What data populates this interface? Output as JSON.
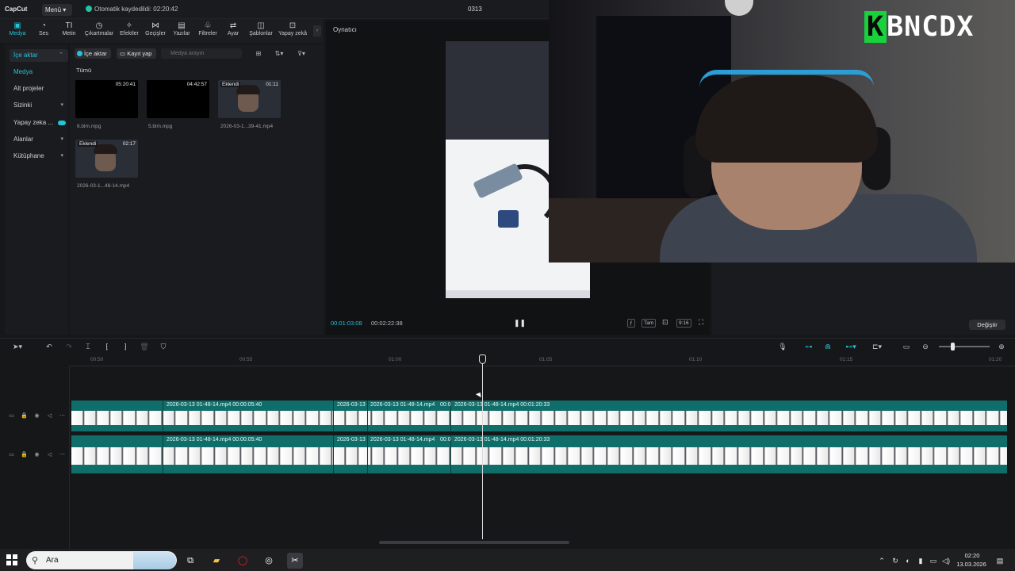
{
  "titlebar": {
    "app_logo": "CapCut",
    "menu_label": "Menü",
    "menu_chevron": "chevron-down-icon",
    "autosave_text": "Otomatik kaydedildi: 02:20:42",
    "project_name": "0313"
  },
  "tools": [
    {
      "label": "Medya",
      "icon": "media-icon",
      "active": true
    },
    {
      "label": "Ses",
      "icon": "audio-icon"
    },
    {
      "label": "Metin",
      "icon": "text-icon"
    },
    {
      "label": "Çıkartmalar",
      "icon": "sticker-icon"
    },
    {
      "label": "Efektler",
      "icon": "effects-icon"
    },
    {
      "label": "Geçişler",
      "icon": "transitions-icon"
    },
    {
      "label": "Yazılar",
      "icon": "captions-icon"
    },
    {
      "label": "Filtreler",
      "icon": "filters-icon"
    },
    {
      "label": "Ayar",
      "icon": "adjust-icon"
    },
    {
      "label": "Şablonlar",
      "icon": "templates-icon"
    },
    {
      "label": "Yapay zekâ",
      "icon": "ai-icon"
    }
  ],
  "sidebar": {
    "items": [
      {
        "label": "İçe aktar"
      },
      {
        "label": "Medya"
      },
      {
        "label": "Alt projeler"
      },
      {
        "label": "Sizinki"
      },
      {
        "label": "Yapay zeka ..."
      },
      {
        "label": "Alanlar"
      },
      {
        "label": "Kütüphane"
      }
    ]
  },
  "media": {
    "import_label": "İçe aktar",
    "record_label": "Kayıt yap",
    "search_placeholder": "Medya arayın",
    "filter_label": "Tümü",
    "items": [
      {
        "name": "6.blm.mpg",
        "duration": "05:20:41",
        "badge": ""
      },
      {
        "name": "5.blm.mpg",
        "duration": "04:42:57",
        "badge": ""
      },
      {
        "name": "2026-03-1...39-41.mp4",
        "duration": "01:11",
        "badge": "Eklendi"
      },
      {
        "name": "2026-03-1...48-14.mp4",
        "duration": "02:17",
        "badge": "Eklendi"
      }
    ]
  },
  "player": {
    "title": "Oynatıcı",
    "current_time": "00:01:03:08",
    "total_time": "00:02:22:38",
    "fit_label": "Tam",
    "ratio_label": "9:16"
  },
  "right_panel": {
    "change_button": "Değiştir"
  },
  "overlay": {
    "brand_letter": "K",
    "brand_rest": "BNCDX"
  },
  "timeline": {
    "ruler_labels": [
      "00:50",
      "00:55",
      "01:00",
      "01:05",
      "01:10",
      "01:15",
      "01:20"
    ],
    "track1": {
      "labels": [
        "2026-03-13 01-48-14.mp4  00:00:05:40",
        "2026-03-13",
        "2026-03-13 01-48-14.mp4",
        "00:0",
        "2026-03-13 01-48-14.mp4  00:01:20:33"
      ]
    },
    "track2": {
      "labels": [
        "2026-03-13 01-48-14.mp4  00:00:05:40",
        "2026-03-13",
        "2026-03-13 01-48-14.mp4",
        "00:0",
        "2026-03-13 01-48-14.mp4  00:01:20:33"
      ]
    }
  },
  "taskbar": {
    "search_placeholder": "Ara",
    "time": "02:20",
    "date": "13.03.2026"
  }
}
